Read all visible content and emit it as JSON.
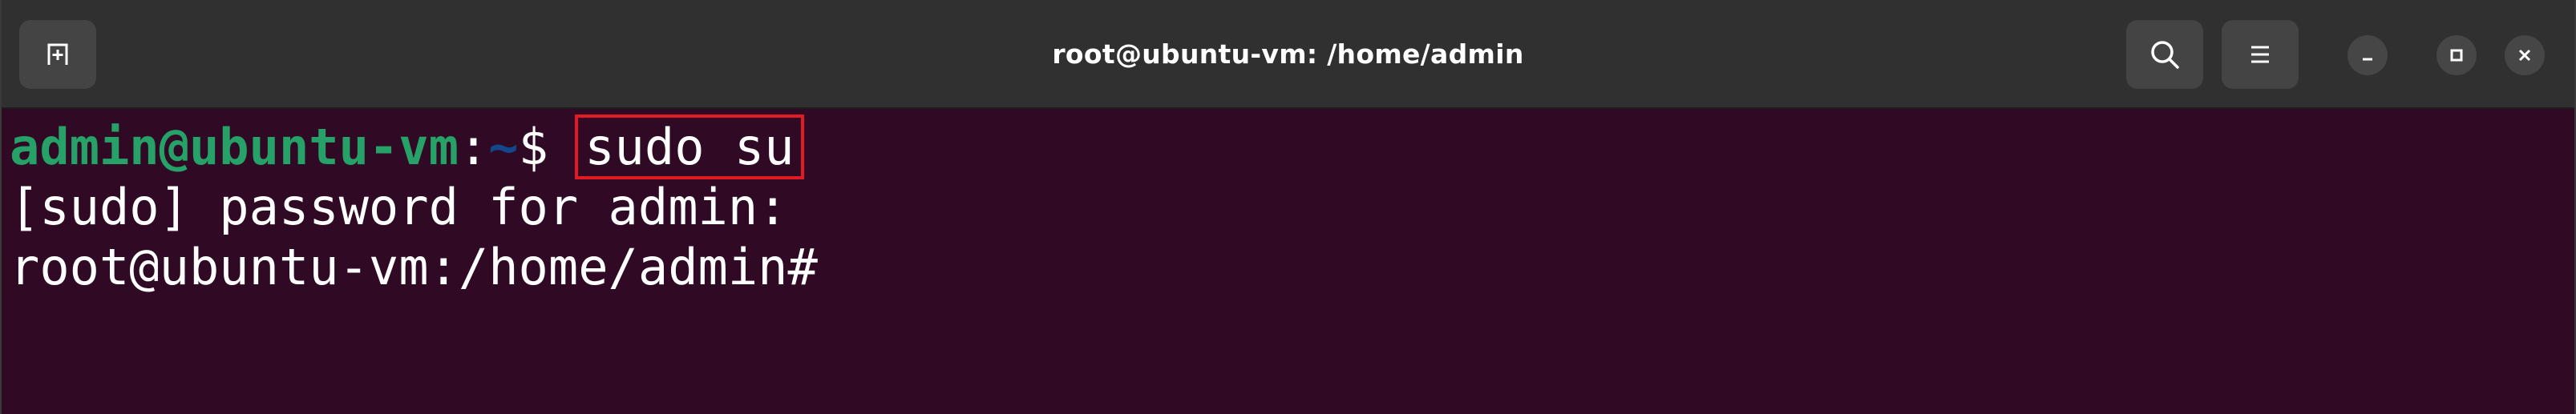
{
  "window": {
    "title": "root@ubuntu-vm: /home/admin"
  },
  "icons": {
    "new_tab": "new-tab-icon",
    "search": "search-icon",
    "menu": "hamburger-menu-icon",
    "minimize": "minimize-icon",
    "maximize": "maximize-icon",
    "close": "close-icon"
  },
  "colors": {
    "terminal_bg": "#300a24",
    "titlebar_bg": "#303030",
    "prompt_user": "#26a269",
    "prompt_path": "#12488b",
    "highlight_border": "#e01b24"
  },
  "terminal": {
    "line1": {
      "user_host": "admin@ubuntu-vm",
      "colon": ":",
      "path": "~",
      "symbol": "$ ",
      "command": "sudo su"
    },
    "line2": "[sudo] password for admin:",
    "line3": "root@ubuntu-vm:/home/admin#"
  }
}
